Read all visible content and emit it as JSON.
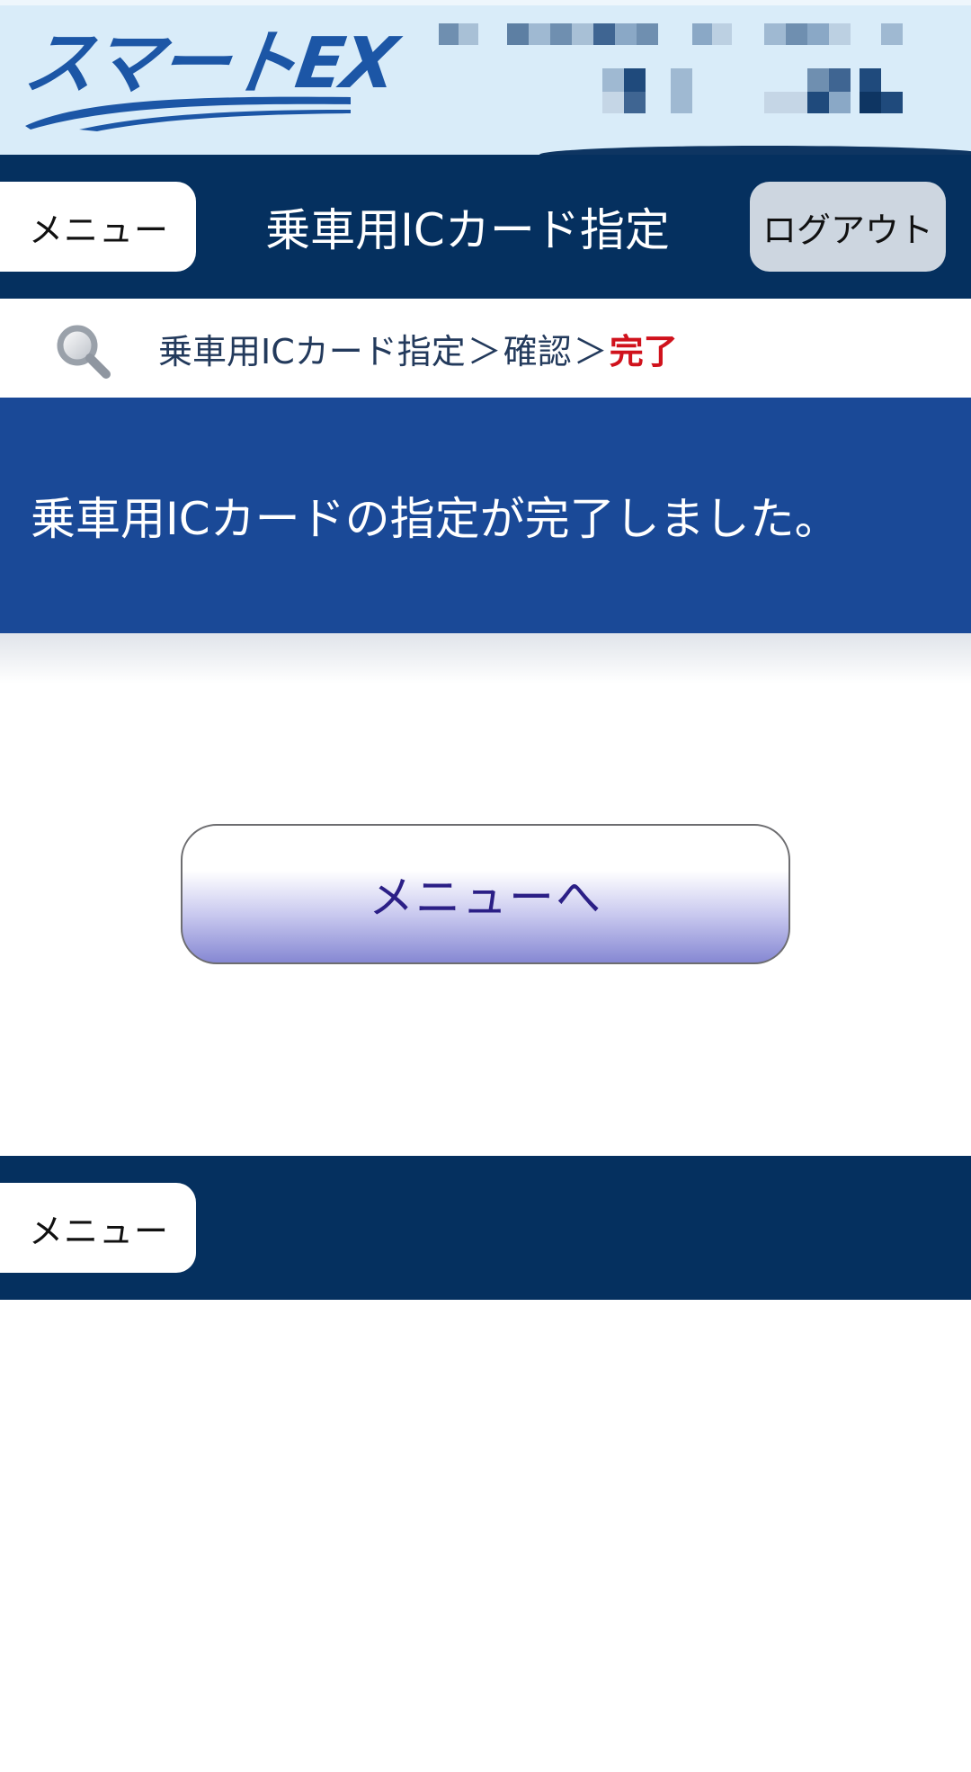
{
  "brand": {
    "logo_text": "スマートEX",
    "logo_color": "#1c56a6"
  },
  "header": {
    "menu_label": "メニュー",
    "title": "乗車用ICカード指定",
    "logout_label": "ログアウト",
    "background": "#05305f"
  },
  "breadcrumb": {
    "icon": "search-icon",
    "steps": [
      "乗車用ICカード指定",
      "確認",
      "完了"
    ],
    "separator": "＞",
    "current_color": "#d0121c"
  },
  "message": {
    "text": "乗車用ICカードの指定が完了しました。",
    "background": "#1a4997"
  },
  "actions": {
    "to_menu_label": "メニューへ"
  },
  "footer": {
    "menu_label": "メニュー"
  }
}
